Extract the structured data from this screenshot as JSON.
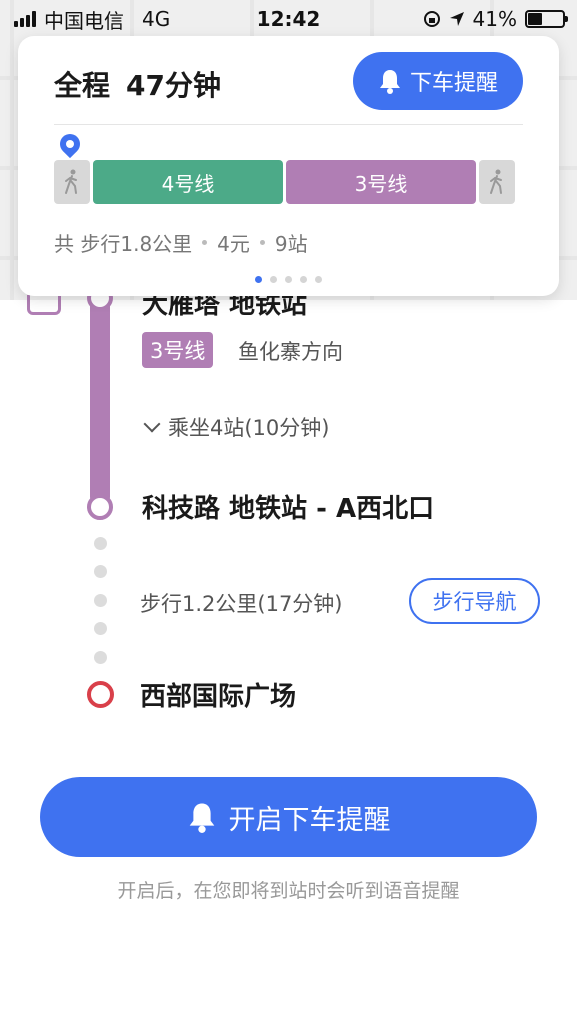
{
  "status_bar": {
    "carrier": "中国电信",
    "network": "4G",
    "time": "12:42",
    "battery_percent_label": "41%",
    "battery_level": 0.41
  },
  "summary": {
    "title_prefix": "全程",
    "total_time": "47分钟",
    "alight_reminder_label": "下车提醒",
    "segments": [
      {
        "type": "walk",
        "icon": "walk-icon"
      },
      {
        "type": "line",
        "label": "4号线",
        "color": "#4caa88"
      },
      {
        "type": "line",
        "label": "3号线",
        "color": "#b07eb4"
      },
      {
        "type": "walk",
        "icon": "walk-icon"
      }
    ],
    "walk_total": "共 步行1.8公里",
    "fare": "4元",
    "stops": "9站",
    "pages": 5,
    "active_page": 1
  },
  "route": {
    "board_station": "大雁塔 地铁站",
    "line_tag": "3号线",
    "direction": "鱼化寨方向",
    "ride_info": "乘坐4站(10分钟)",
    "alight_station": "科技路 地铁站 - A西北口",
    "walk_info": "步行1.2公里(17分钟)",
    "walk_nav_label": "步行导航",
    "destination": "西部国际广场",
    "line_color": "#b07eb4",
    "destination_color": "#d9404a"
  },
  "cta": {
    "label": "开启下车提醒",
    "hint": "开启后，在您即将到站时会听到语音提醒"
  },
  "colors": {
    "accent": "#3f72f0"
  }
}
